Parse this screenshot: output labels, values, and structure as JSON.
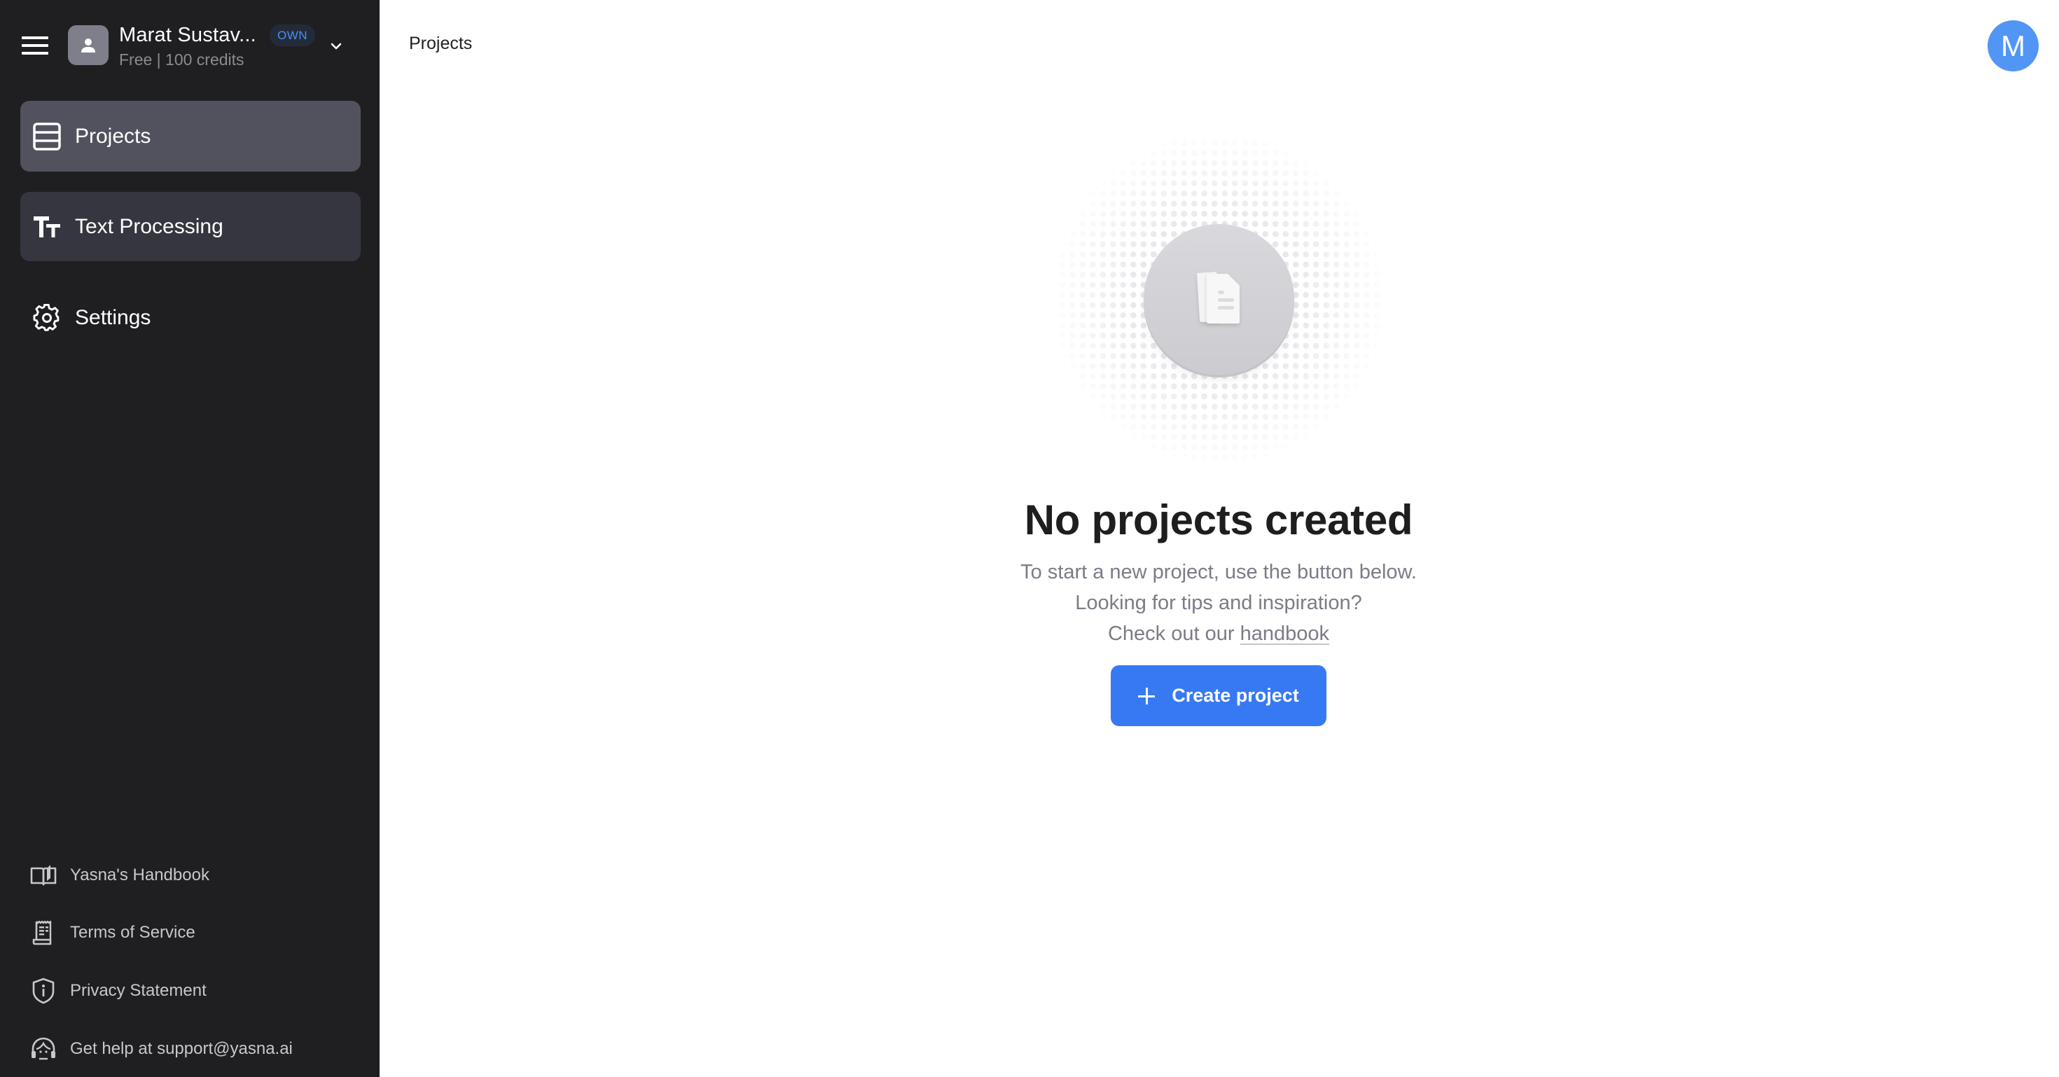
{
  "sidebar": {
    "account": {
      "name": "Marat Sustav...",
      "badge": "OWN",
      "plan": "Free | 100 credits"
    },
    "nav": [
      {
        "label": "Projects",
        "icon": "table-rows-icon",
        "active": true
      },
      {
        "label": "Text Processing",
        "icon": "text-size-icon",
        "active": false
      },
      {
        "label": "Settings",
        "icon": "gear-icon",
        "active": false
      }
    ],
    "footer": [
      {
        "label": "Yasna's Handbook",
        "icon": "book-icon"
      },
      {
        "label": "Terms of Service",
        "icon": "receipt-icon"
      },
      {
        "label": "Privacy Statement",
        "icon": "shield-info-icon"
      },
      {
        "label": "Get help at support@yasna.ai",
        "icon": "headset-icon"
      }
    ]
  },
  "header": {
    "breadcrumb": "Projects",
    "user_initial": "M"
  },
  "empty_state": {
    "title": "No projects created",
    "line1": "To start a new project, use the button below.",
    "line2": "Looking for tips and inspiration?",
    "line3_prefix": "Check out our ",
    "line3_link": "handbook",
    "button_label": "Create project"
  },
  "colors": {
    "sidebar_bg": "#1f1f21",
    "active_item_bg": "#52525f",
    "accent": "#3779f3",
    "avatar": "#5196f5",
    "badge_text": "#4b8ef0"
  }
}
